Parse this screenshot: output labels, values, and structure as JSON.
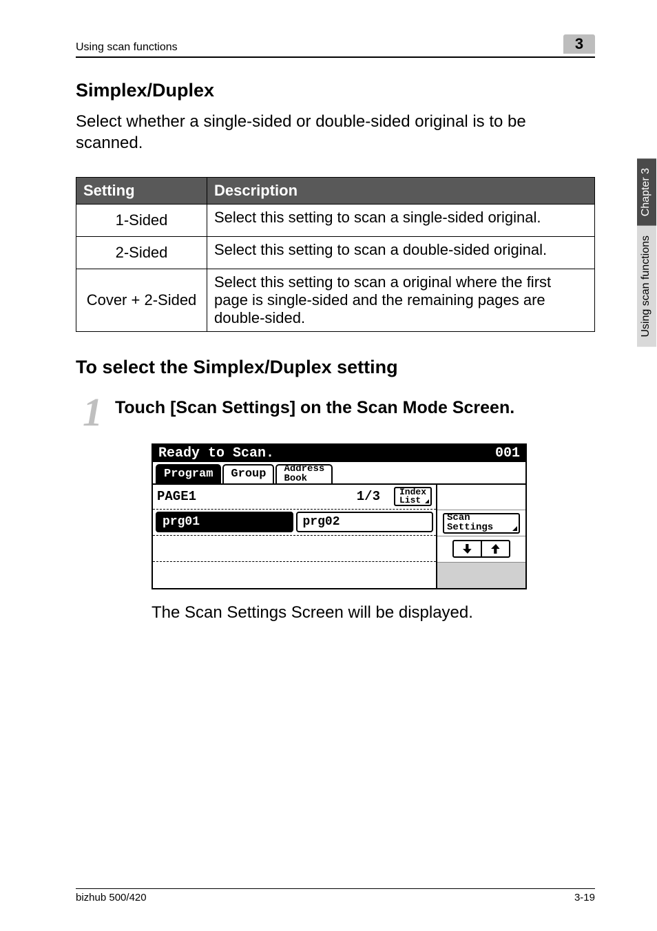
{
  "header": {
    "breadcrumb": "Using scan functions",
    "chapter_number": "3"
  },
  "section": {
    "title": "Simplex/Duplex",
    "intro": "Select whether a single-sided or double-sided original is to be scanned."
  },
  "table": {
    "headers": {
      "col1": "Setting",
      "col2": "Description"
    },
    "rows": [
      {
        "name": "1-Sided",
        "desc": "Select this setting to scan a single-sided original."
      },
      {
        "name": "2-Sided",
        "desc": "Select this setting to scan a double-sided original."
      },
      {
        "name": "Cover + 2-Sided",
        "desc": "Select this setting to scan a original where the first page is single-sided and the remaining pages are double-sided."
      }
    ]
  },
  "subsection": {
    "title": "To select the Simplex/Duplex setting"
  },
  "step": {
    "number": "1",
    "text": "Touch [Scan Settings] on the Scan Mode Screen.",
    "result": "The Scan Settings Screen will be displayed."
  },
  "lcd": {
    "status_left": "Ready to Scan.",
    "status_right": "001",
    "tabs": {
      "program": "Program",
      "group": "Group",
      "address_book": "Address\nBook"
    },
    "page_label": "PAGE1",
    "page_fraction": "1/3",
    "index_btn": "Index\nList",
    "slot1": "prg01",
    "slot2": "prg02",
    "scan_settings": "Scan\nSettings",
    "arrow_down": "↓",
    "arrow_up": "↑"
  },
  "sidetab": {
    "dark": "Chapter 3",
    "light": "Using scan functions"
  },
  "footer": {
    "left": "bizhub 500/420",
    "right": "3-19"
  }
}
